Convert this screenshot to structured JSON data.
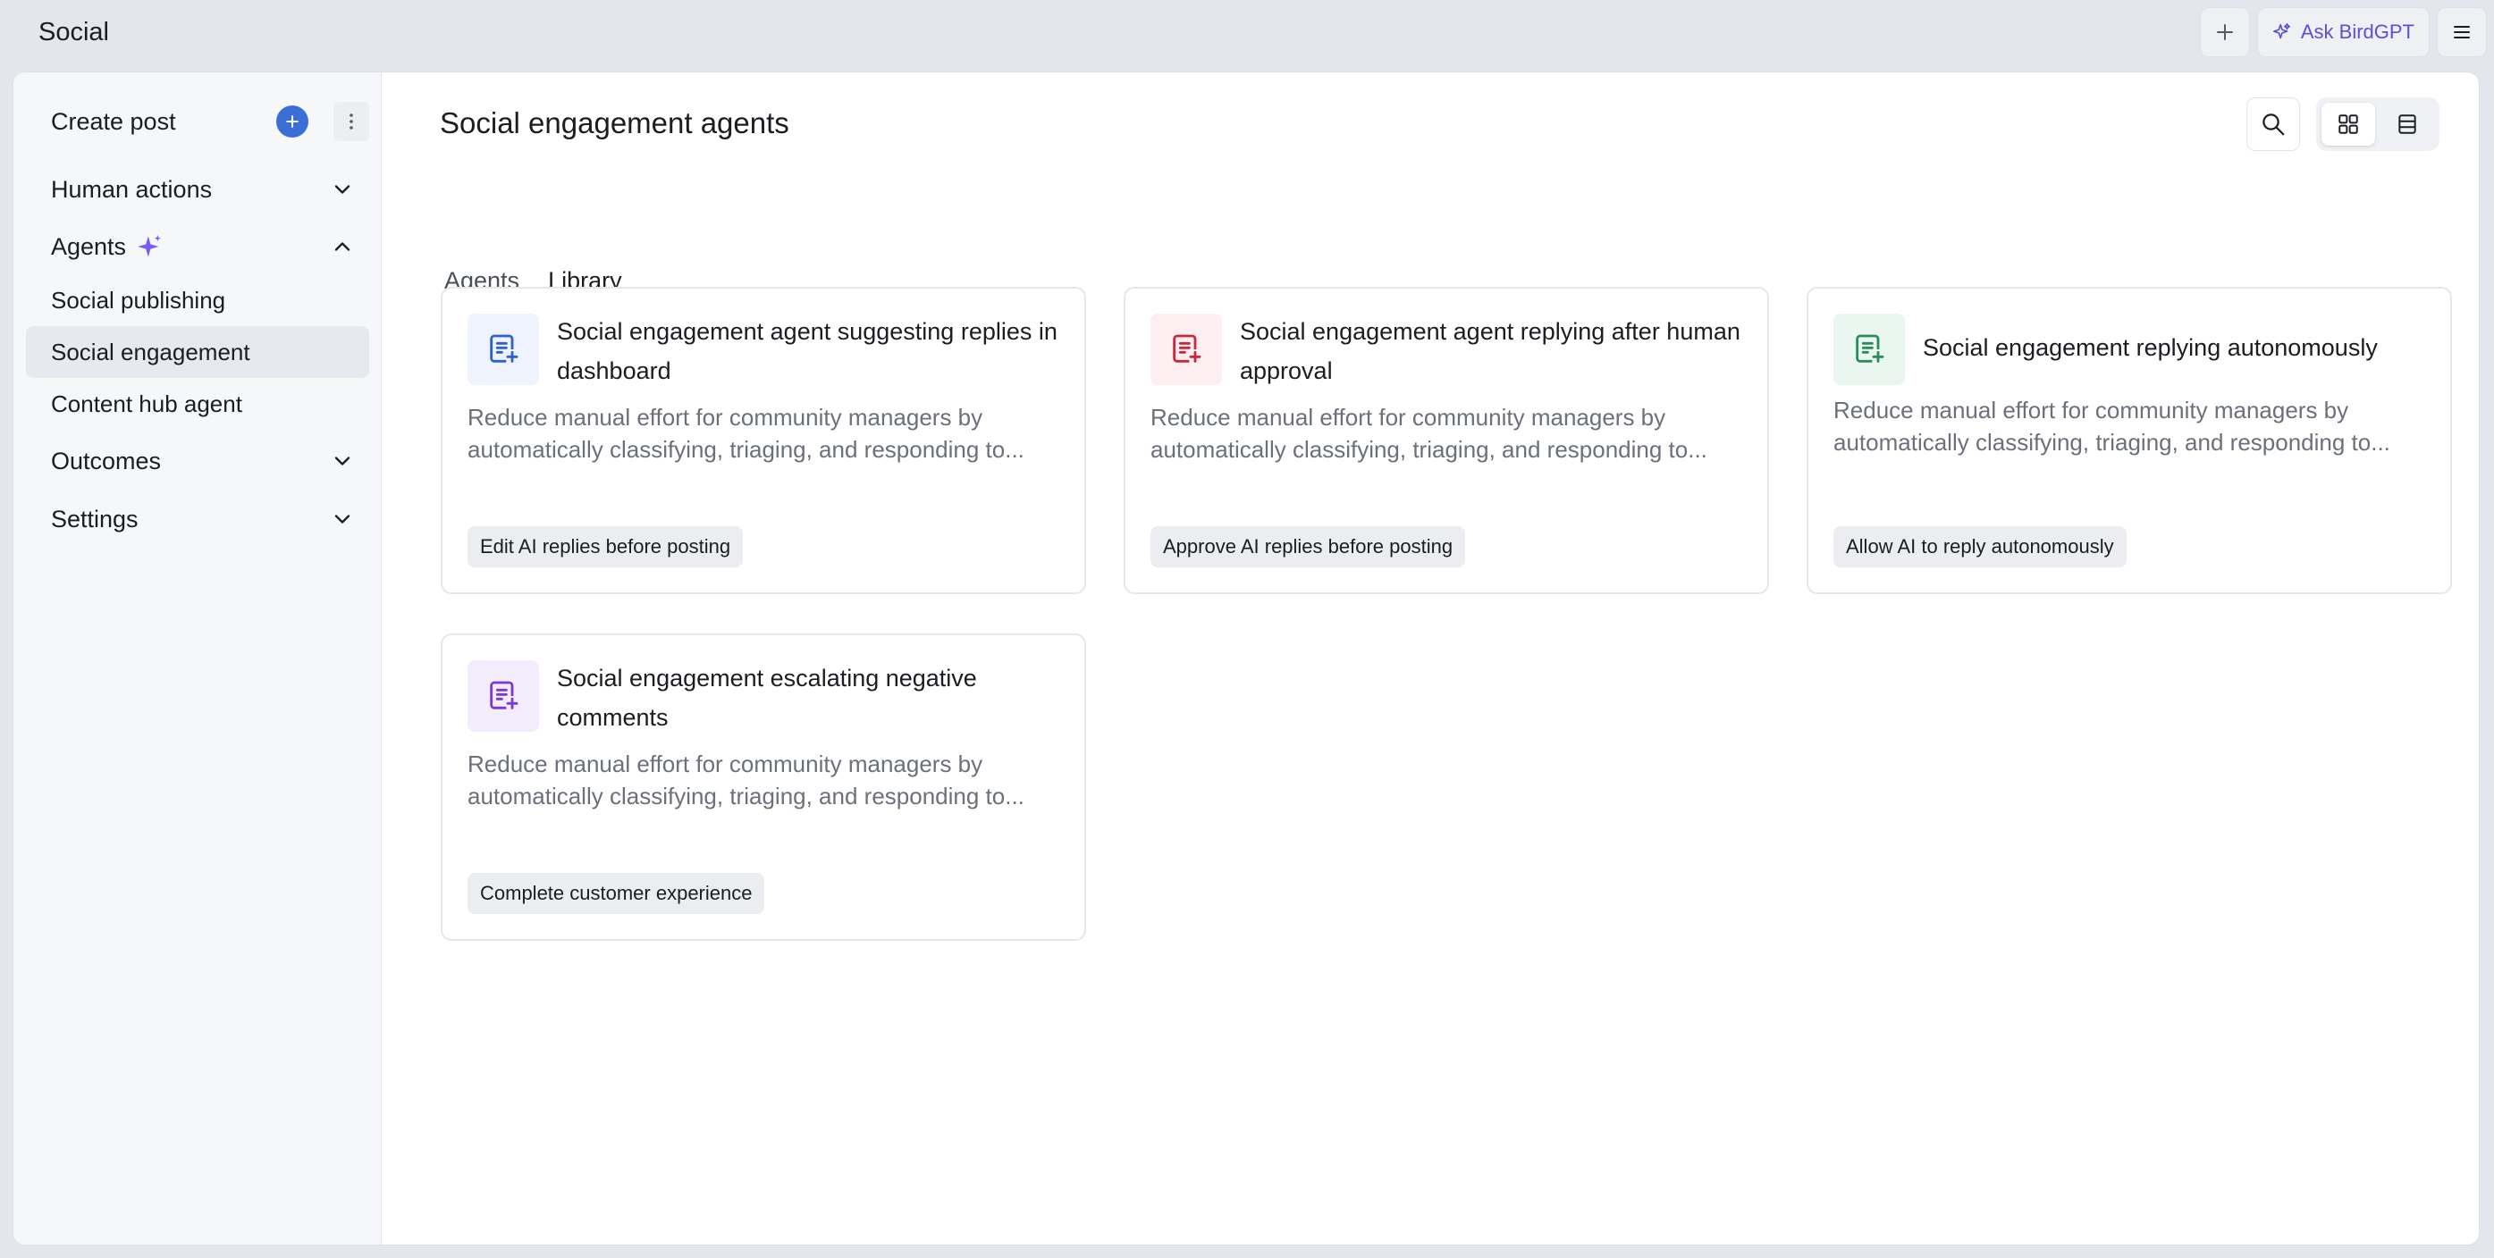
{
  "app": {
    "title": "Social"
  },
  "topbar": {
    "ask_label": "Ask BirdGPT"
  },
  "sidebar": {
    "create_post": "Create post",
    "sections": [
      {
        "label": "Human actions"
      },
      {
        "label": "Agents"
      },
      {
        "label": "Outcomes"
      },
      {
        "label": "Settings"
      }
    ],
    "agent_items": [
      {
        "label": "Social publishing"
      },
      {
        "label": "Social engagement"
      },
      {
        "label": "Content hub agent"
      }
    ]
  },
  "main": {
    "title": "Social engagement agents",
    "tabs": [
      {
        "label": "Agents"
      },
      {
        "label": "Library"
      }
    ],
    "cards": [
      {
        "title": "Social engagement agent suggesting replies in dashboard",
        "description": "Reduce manual effort for community managers by automatically classifying, triaging, and responding to...",
        "tag": "Edit AI replies before posting",
        "icon_color": "#2f5fd0",
        "icon_bg": "#eef3fd"
      },
      {
        "title": "Social engagement agent replying after human approval",
        "description": "Reduce manual effort for community managers by automatically classifying, triaging, and responding to...",
        "tag": "Approve AI replies before posting",
        "icon_color": "#c8283c",
        "icon_bg": "#fdeff1"
      },
      {
        "title": "Social engagement replying autonomously",
        "description": "Reduce manual effort for community managers by automatically classifying, triaging, and responding to...",
        "tag": "Allow AI to reply autonomously",
        "icon_color": "#2e8a5a",
        "icon_bg": "#eaf7f0"
      },
      {
        "title": "Social engagement escalating negative comments",
        "description": "Reduce manual effort for community managers by automatically classifying, triaging, and responding to...",
        "tag": "Complete customer experience",
        "icon_color": "#7a3ad6",
        "icon_bg": "#f3ecfd"
      }
    ]
  },
  "colors": {
    "accent": "#3b6fd6",
    "sparkle": "#7a5af8"
  }
}
